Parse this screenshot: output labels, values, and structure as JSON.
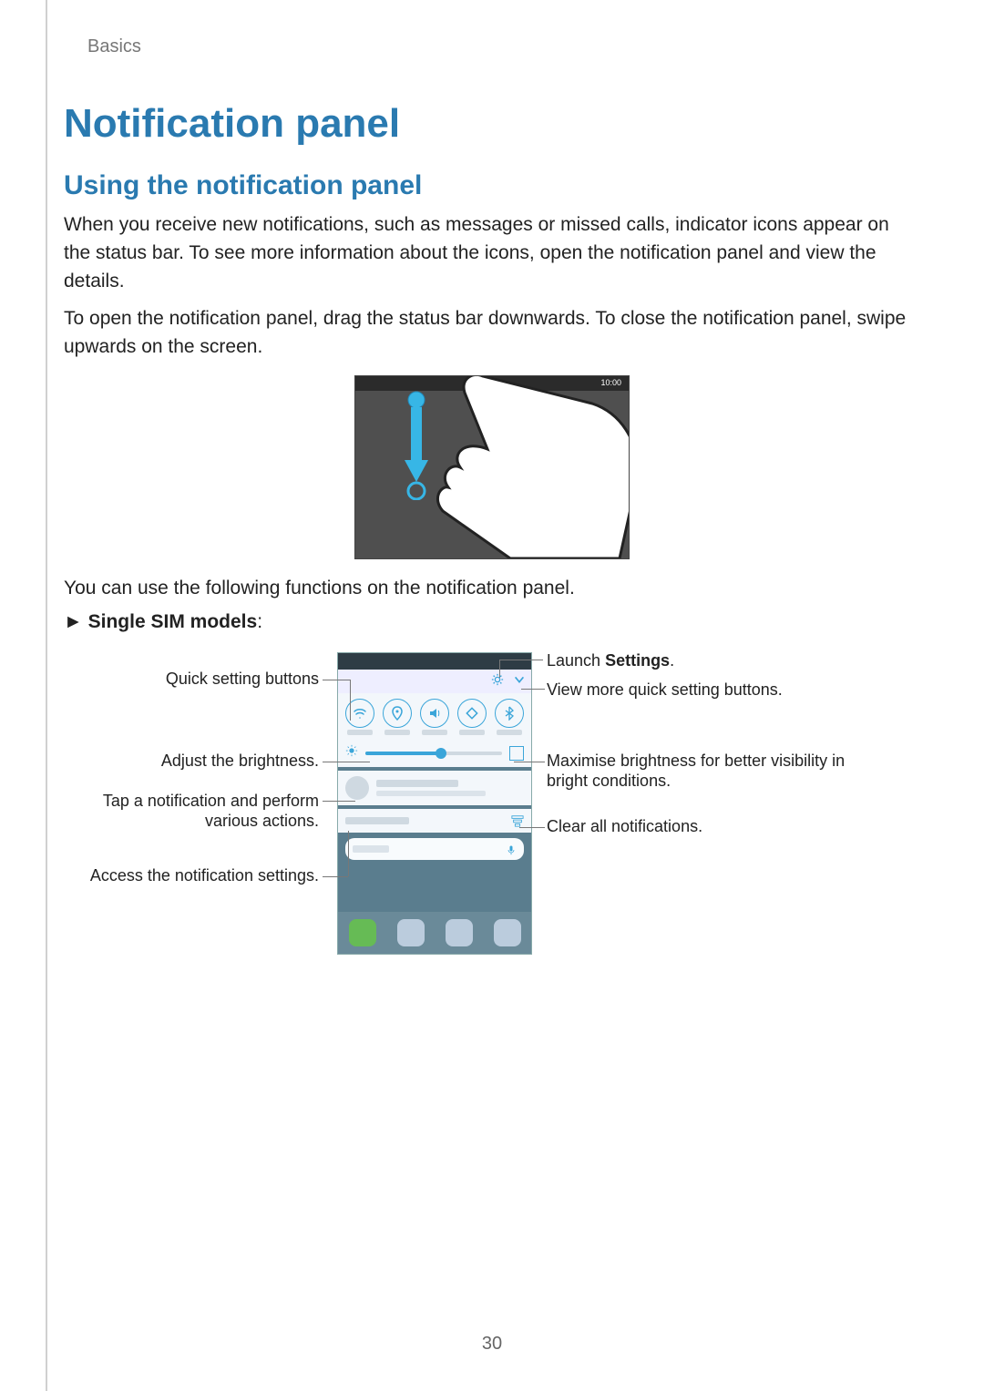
{
  "running_header": "Basics",
  "h1": "Notification panel",
  "h2": "Using the notification panel",
  "para1": "When you receive new notifications, such as messages or missed calls, indicator icons appear on the status bar. To see more information about the icons, open the notification panel and view the details.",
  "para2": "To open the notification panel, drag the status bar downwards. To close the notification panel, swipe upwards on the screen.",
  "illus1_time": "10:00",
  "para3": "You can use the following functions on the notification panel.",
  "single_sim_prefix": "►",
  "single_sim_label": "Single SIM models",
  "single_sim_colon": ":",
  "callouts": {
    "left": [
      "Quick setting buttons",
      "Adjust the brightness.",
      "Tap a notification and perform various actions.",
      "Access the notification settings."
    ],
    "right_settings_prefix": "Launch ",
    "right_settings_bold": "Settings",
    "right_settings_suffix": ".",
    "right": [
      "View more quick setting buttons.",
      "Maximise brightness for better visibility in bright conditions.",
      "Clear all notifications."
    ]
  },
  "page_number": "30"
}
